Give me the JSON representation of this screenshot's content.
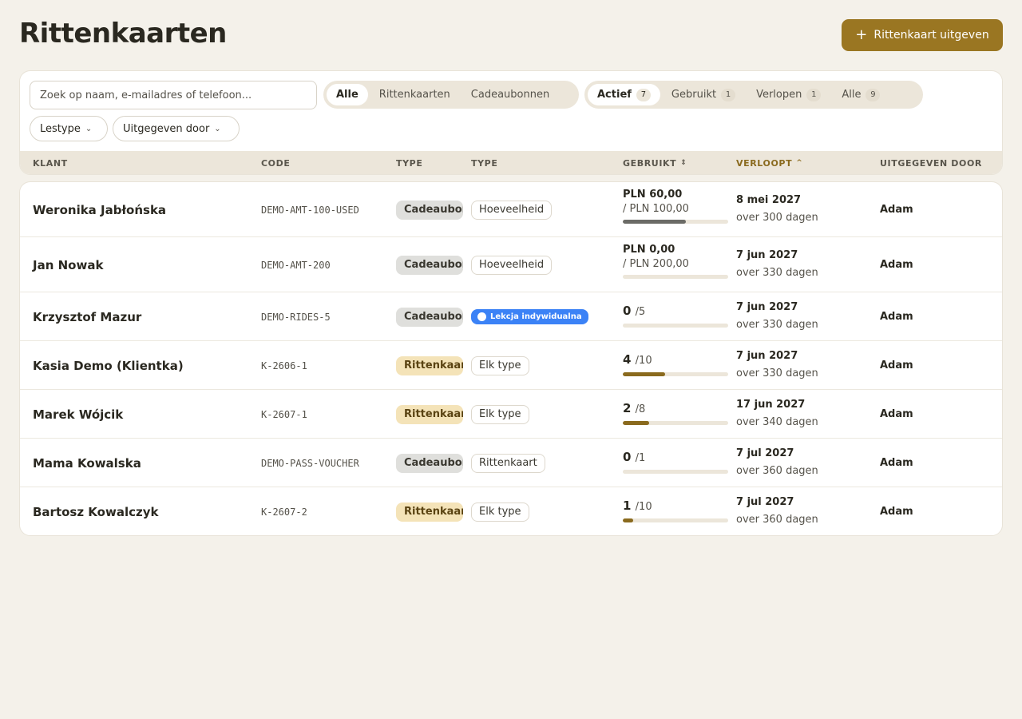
{
  "page": {
    "title": "Rittenkaarten",
    "issue_button_label": "Rittenkaart uitgeven",
    "issue_button_icon": "plus-icon"
  },
  "search": {
    "placeholder": "Zoek op naam, e-mailadres of telefoon..."
  },
  "type_filter": {
    "items": [
      {
        "label": "Alle",
        "active": true
      },
      {
        "label": "Rittenkaarten",
        "active": false
      },
      {
        "label": "Cadeaubonnen",
        "active": false
      }
    ]
  },
  "status_filter": {
    "items": [
      {
        "label": "Actief",
        "count": "7",
        "active": true
      },
      {
        "label": "Gebruikt",
        "count": "1",
        "active": false
      },
      {
        "label": "Verlopen",
        "count": "1",
        "active": false
      },
      {
        "label": "Alle",
        "count": "9",
        "active": false
      }
    ]
  },
  "dropdowns": {
    "lesson_type": "Lestype",
    "issued_by": "Uitgegeven door"
  },
  "columns": {
    "client": "KLANT",
    "code": "CODE",
    "type1": "TYPE",
    "type2": "TYPE",
    "used": "GEBRUIKT",
    "expires": "VERLOOPT",
    "issuer": "UITGEGEVEN DOOR"
  },
  "colors": {
    "accent": "#9a7622",
    "used_bar_amount": "#6b6b66",
    "used_bar_rides": "#8a6a1e",
    "lesson_badge": "#3b82f6"
  },
  "rows": [
    {
      "name": "Weronika Jabłońska",
      "code": "DEMO-AMT-100-USED",
      "type": "Cadeaubon",
      "type_style": "gift",
      "sub": "Hoeveelheid",
      "sub_style": "outline",
      "usage_kind": "amount",
      "used": "PLN 60,00",
      "total": "/ PLN 100,00",
      "fraction": 0.6,
      "date": "8 mei 2027",
      "relative": "over 300 dagen",
      "issuer": "Adam"
    },
    {
      "name": "Jan Nowak",
      "code": "DEMO-AMT-200",
      "type": "Cadeaubon",
      "type_style": "gift",
      "sub": "Hoeveelheid",
      "sub_style": "outline",
      "usage_kind": "amount",
      "used": "PLN 0,00",
      "total": "/ PLN 200,00",
      "fraction": 0,
      "date": "7 jun 2027",
      "relative": "over 330 dagen",
      "issuer": "Adam"
    },
    {
      "name": "Krzysztof Mazur",
      "code": "DEMO-RIDES-5",
      "type": "Cadeaubon",
      "type_style": "gift",
      "sub": "Lekcja indywidualna",
      "sub_style": "blue",
      "usage_kind": "count",
      "used": "0",
      "total": "/5",
      "fraction": 0,
      "date": "7 jun 2027",
      "relative": "over 330 dagen",
      "issuer": "Adam"
    },
    {
      "name": "Kasia Demo (Klientka)",
      "code": "K-2606-1",
      "type": "Rittenkaart",
      "type_style": "ride",
      "sub": "Elk type",
      "sub_style": "outline",
      "usage_kind": "count",
      "used": "4",
      "total": "/10",
      "fraction": 0.4,
      "date": "7 jun 2027",
      "relative": "over 330 dagen",
      "issuer": "Adam"
    },
    {
      "name": "Marek Wójcik",
      "code": "K-2607-1",
      "type": "Rittenkaart",
      "type_style": "ride",
      "sub": "Elk type",
      "sub_style": "outline",
      "usage_kind": "count",
      "used": "2",
      "total": "/8",
      "fraction": 0.25,
      "date": "17 jun 2027",
      "relative": "over 340 dagen",
      "issuer": "Adam"
    },
    {
      "name": "Mama Kowalska",
      "code": "DEMO-PASS-VOUCHER",
      "type": "Cadeaubon",
      "type_style": "gift",
      "sub": "Rittenkaart",
      "sub_style": "outline",
      "usage_kind": "count",
      "used": "0",
      "total": "/1",
      "fraction": 0,
      "date": "7 jul 2027",
      "relative": "over 360 dagen",
      "issuer": "Adam"
    },
    {
      "name": "Bartosz Kowalczyk",
      "code": "K-2607-2",
      "type": "Rittenkaart",
      "type_style": "ride",
      "sub": "Elk type",
      "sub_style": "outline",
      "usage_kind": "count",
      "used": "1",
      "total": "/10",
      "fraction": 0.1,
      "date": "7 jul 2027",
      "relative": "over 360 dagen",
      "issuer": "Adam"
    }
  ]
}
